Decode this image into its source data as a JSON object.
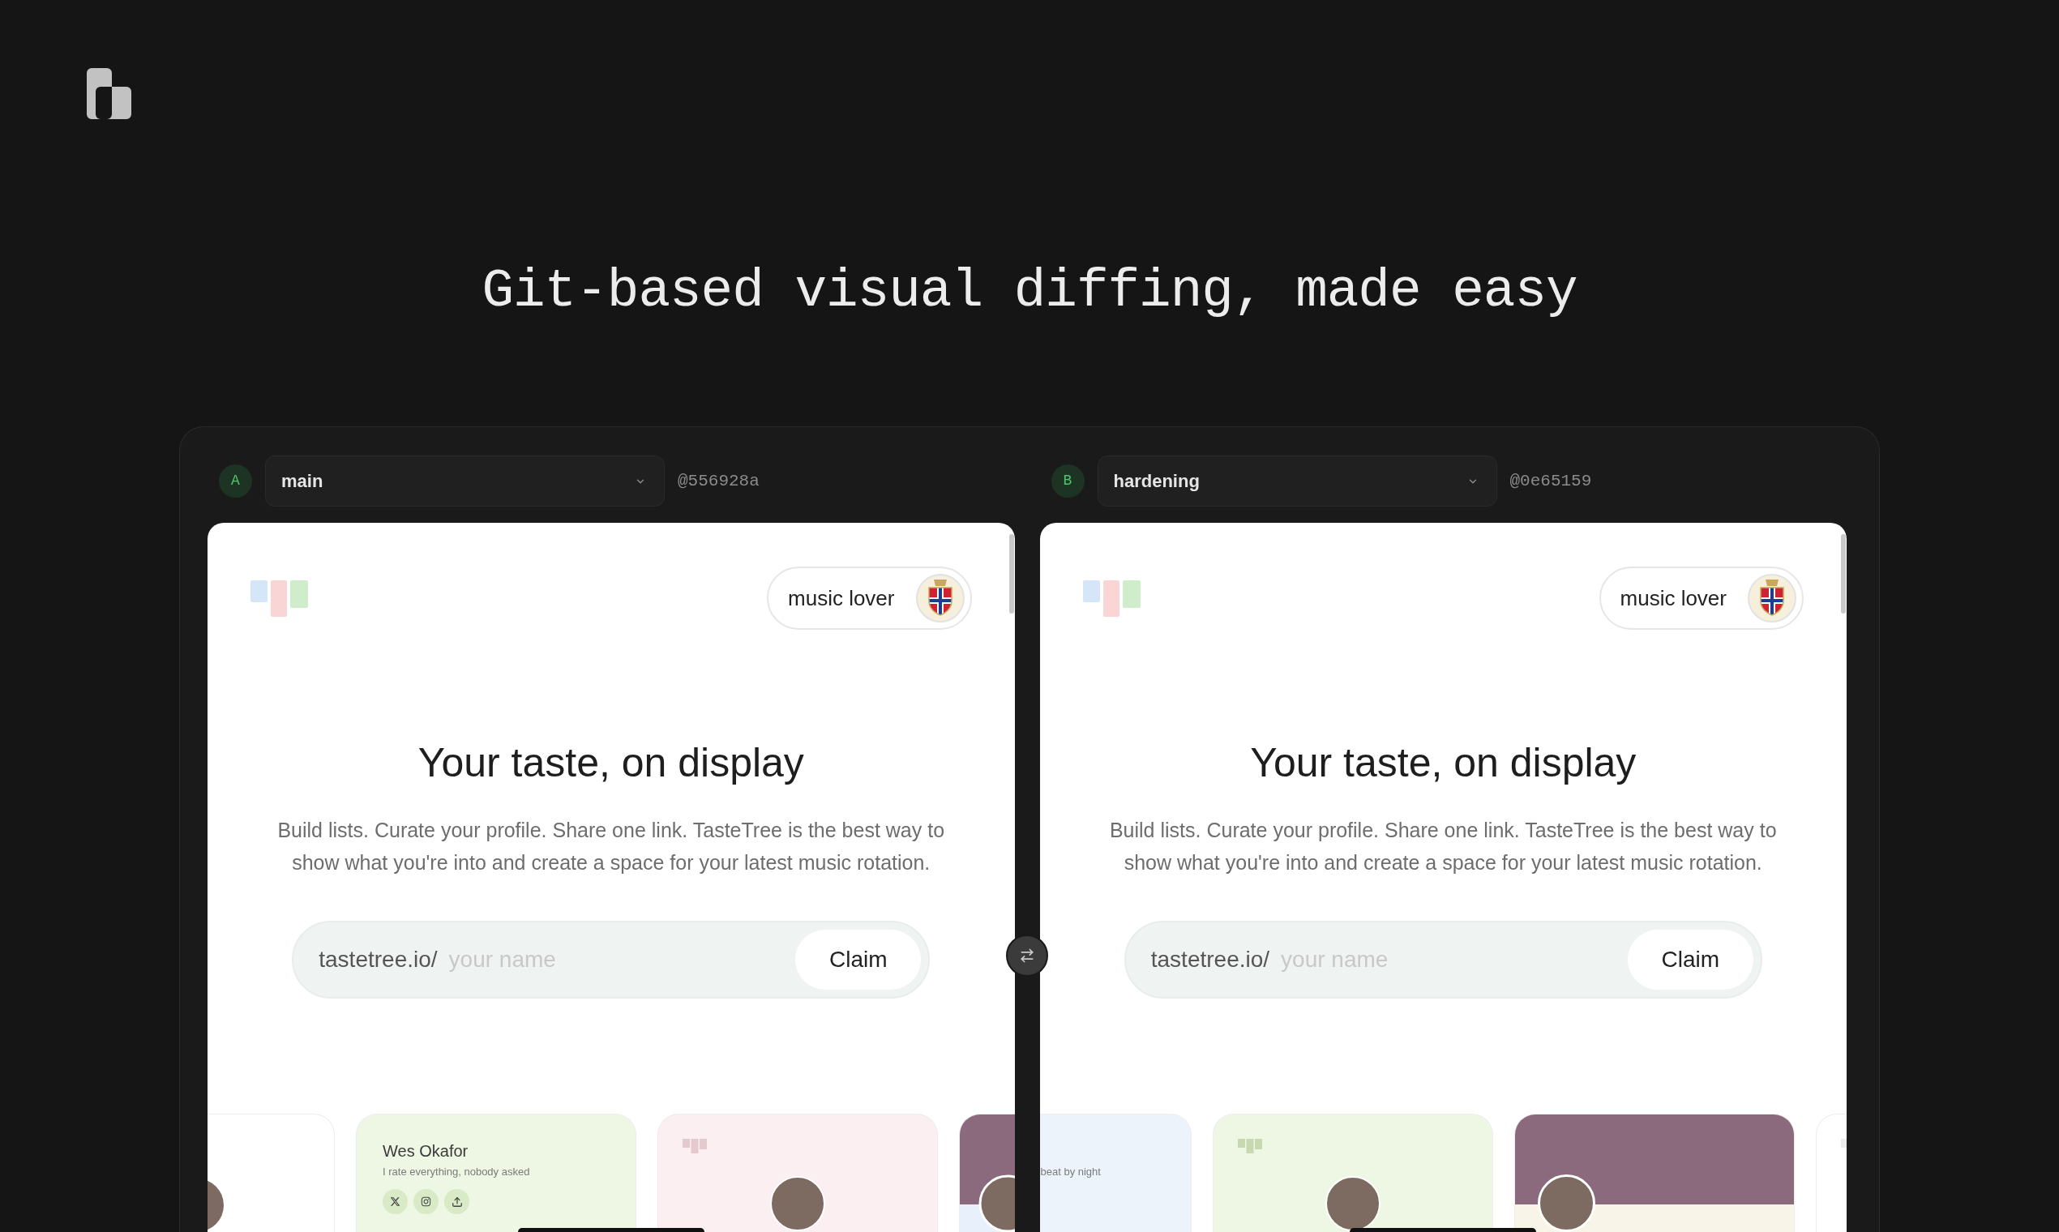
{
  "headline": "Git-based visual diffing, made easy",
  "comparison": {
    "sides": [
      {
        "badge": "A",
        "branch": "main",
        "commit": "@556928a",
        "preview": {
          "chip": "music lover",
          "heading": "Your taste, on display",
          "body": "Build lists. Curate your profile. Share one link. TasteTree is the best way to show what you're into and create a space for your latest music rotation.",
          "url_prefix": "tastetree.io/",
          "placeholder": "your name",
          "button": "Claim",
          "cards": [
            {
              "kind": "avatar",
              "color": "#ffffff"
            },
            {
              "kind": "profile",
              "color": "#eef6e4",
              "name": "Wes Okafor",
              "bio": "I rate everything, nobody asked"
            },
            {
              "kind": "avatar",
              "color": "#fbeff1"
            },
            {
              "kind": "photo",
              "color": "#e8f0fb"
            }
          ]
        }
      },
      {
        "badge": "B",
        "branch": "hardening",
        "commit": "@0e65159",
        "preview": {
          "chip": "music lover",
          "heading": "Your taste, on display",
          "body": "Build lists. Curate your profile. Share one link. TasteTree is the best way to show what you're into and create a space for your latest music rotation.",
          "url_prefix": "tastetree.io/",
          "placeholder": "your name",
          "button": "Claim",
          "cards": [
            {
              "kind": "profile",
              "color": "#edf3fb",
              "bio": "beat by night"
            },
            {
              "kind": "avatar",
              "color": "#eef6e4"
            },
            {
              "kind": "photo",
              "color": "#f8f5e8"
            },
            {
              "kind": "avatar",
              "color": "#ffffff"
            }
          ]
        }
      }
    ]
  }
}
